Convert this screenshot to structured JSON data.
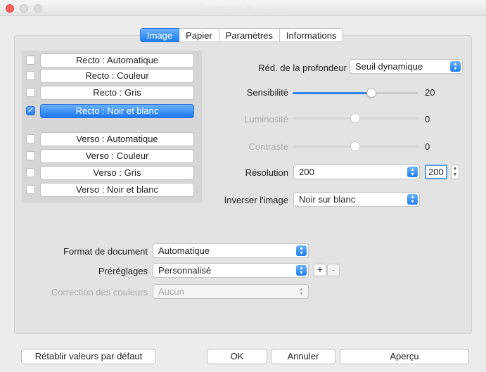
{
  "window": {
    "title": "Paramètres du scanner"
  },
  "tabs": [
    {
      "label": "Image",
      "active": true
    },
    {
      "label": "Papier",
      "active": false
    },
    {
      "label": "Paramètres",
      "active": false
    },
    {
      "label": "Informations",
      "active": false
    }
  ],
  "modes": [
    {
      "label": "Recto : Automatique",
      "checked": false
    },
    {
      "label": "Recto : Couleur",
      "checked": false
    },
    {
      "label": "Recto : Gris",
      "checked": false
    },
    {
      "label": "Recto : Noir et blanc",
      "checked": true
    },
    {
      "label": "Verso : Automatique",
      "checked": false
    },
    {
      "label": "Verso : Couleur",
      "checked": false
    },
    {
      "label": "Verso : Gris",
      "checked": false
    },
    {
      "label": "Verso : Noir et blanc",
      "checked": false
    }
  ],
  "settings": {
    "depth_reduction": {
      "label": "Réd. de la profondeur",
      "value": "Seuil dynamique"
    },
    "sensitivity": {
      "label": "Sensibilité",
      "value": "20",
      "fraction": 0.63
    },
    "brightness": {
      "label": "Luminosité",
      "value": "0",
      "fraction": 0.5
    },
    "contrast": {
      "label": "Contraste",
      "value": "0",
      "fraction": 0.5
    },
    "resolution": {
      "label": "Résolution",
      "value": "200",
      "stepper_value": "200"
    },
    "invert": {
      "label": "Inverser l'image",
      "value": "Noir sur blanc"
    }
  },
  "document": {
    "format": {
      "label": "Format de document",
      "value": "Automatique"
    },
    "presets": {
      "label": "Préréglages",
      "value": "Personnalisé",
      "add": "+",
      "remove": "-"
    },
    "color_correction": {
      "label": "Correction des couleurs",
      "value": "Aucun"
    }
  },
  "footer": {
    "reset": "Rétablir valeurs par défaut",
    "ok": "OK",
    "cancel": "Annuler",
    "preview": "Aperçu"
  },
  "colors": {
    "accent": "#1d7cf2",
    "close": "#fc605c"
  }
}
